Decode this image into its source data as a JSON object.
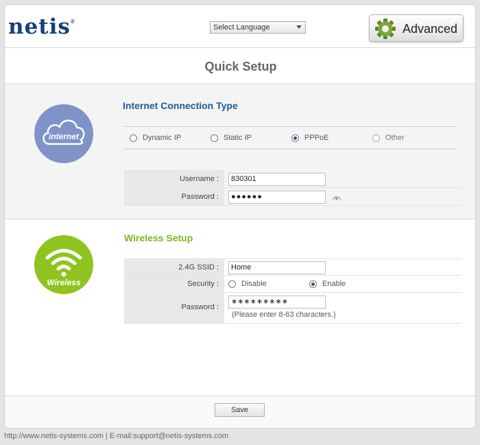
{
  "header": {
    "logo_text": "netis",
    "logo_mark": "®",
    "language_select": "Select Language",
    "advanced_label": "Advanced"
  },
  "page_title": "Quick Setup",
  "internet": {
    "icon_caption": "internet",
    "section_title": "Internet Connection Type",
    "connection_types": [
      {
        "label": "Dynamic IP",
        "selected": false
      },
      {
        "label": "Static IP",
        "selected": false
      },
      {
        "label": "PPPoE",
        "selected": true
      },
      {
        "label": "Other",
        "selected": false
      }
    ],
    "username_label": "Username :",
    "username_value": "830301",
    "password_label": "Password :",
    "password_value": "●●●●●●"
  },
  "wireless": {
    "icon_caption": "Wireless",
    "section_title": "Wireless Setup",
    "ssid_label": "2.4G SSID :",
    "ssid_value": "Home",
    "security_label": "Security :",
    "security_options": [
      {
        "label": "Disable",
        "selected": false
      },
      {
        "label": "Enable",
        "selected": true
      }
    ],
    "password_label": "Password :",
    "password_value": "∗∗∗∗∗∗∗∗∗",
    "password_hint": "(Please enter 8-63 characters.)"
  },
  "footer": {
    "save_label": "Save",
    "contact_text": "http://www.netis-systems.com | E-mail:support@netis-systems.com"
  },
  "colors": {
    "brand_blue": "#1a3f7a",
    "internet_circle": "#7f93c9",
    "wireless_circle": "#8fc31f",
    "internet_title": "#1c5b98",
    "wireless_title": "#7ab51d"
  }
}
